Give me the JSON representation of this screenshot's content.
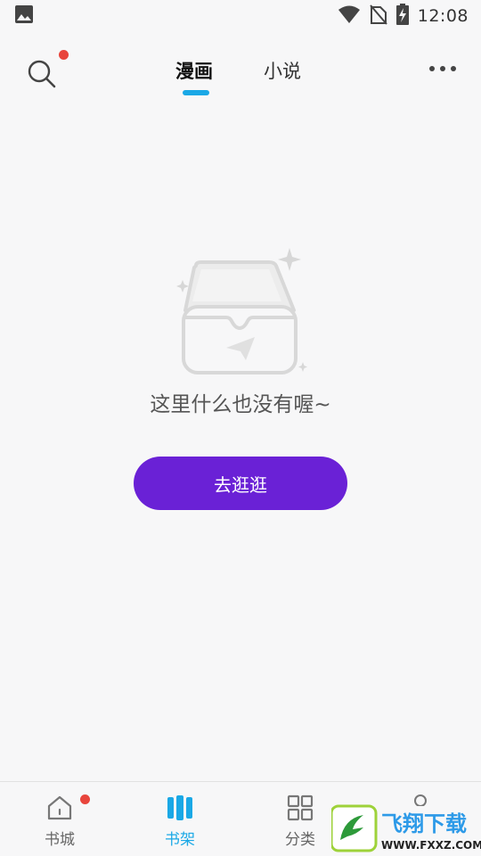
{
  "status_bar": {
    "time": "12:08",
    "icons": [
      "image-icon",
      "wifi-icon",
      "no-sim-icon",
      "battery-charging-icon"
    ]
  },
  "header": {
    "tabs": [
      {
        "label": "漫画",
        "active": true
      },
      {
        "label": "小说",
        "active": false
      }
    ],
    "search_icon": "search-icon",
    "more_icon": "more-horizontal-icon",
    "has_notification_dot": true
  },
  "empty_state": {
    "icon": "empty-inbox-icon",
    "message": "这里什么也没有喔~",
    "button_label": "去逛逛"
  },
  "bottom_nav": {
    "items": [
      {
        "label": "书城",
        "icon": "home-icon",
        "active": false,
        "badge": true
      },
      {
        "label": "书架",
        "icon": "bookshelf-icon",
        "active": true,
        "badge": false
      },
      {
        "label": "分类",
        "icon": "category-icon",
        "active": false,
        "badge": false
      }
    ]
  },
  "watermark": {
    "title": "飞翔下载",
    "url": "WWW.FXXZ.COM"
  },
  "colors": {
    "accent": "#1aa8e6",
    "button": "#6a21d6",
    "badge": "#e8453c",
    "background": "#f7f7f8"
  }
}
